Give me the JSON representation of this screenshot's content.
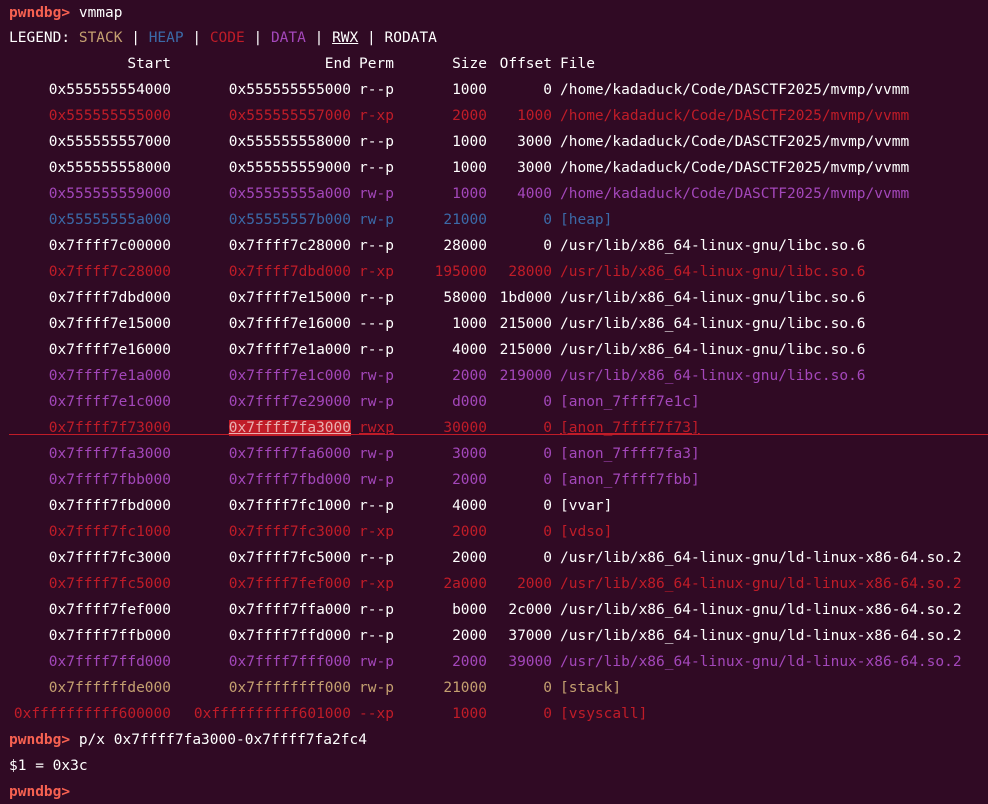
{
  "colors": {
    "prompt": "#f66151",
    "plain": "#ffffff",
    "stack": "#c4a070",
    "heap": "#3b6aa8",
    "code": "#c01c28",
    "data": "#a347ba",
    "background": "#300a24"
  },
  "prompt": "pwndbg>",
  "command_vmmap": "vmmap",
  "legend": {
    "label": "LEGEND:",
    "stack": "STACK",
    "heap": "HEAP",
    "code": "CODE",
    "data": "DATA",
    "rwx": "RWX",
    "rodata": "RODATA",
    "sep": " | "
  },
  "headers": {
    "start": "Start",
    "end": "End",
    "perm": "Perm",
    "size": "Size",
    "offset": "Offset",
    "file": "File"
  },
  "rows": [
    {
      "start": "0x555555554000",
      "end": "0x555555555000",
      "perm": "r--p",
      "size": "1000",
      "offset": "0",
      "file": "/home/kadaduck/Code/DASCTF2025/mvmp/vvmm",
      "kind": "plain"
    },
    {
      "start": "0x555555555000",
      "end": "0x555555557000",
      "perm": "r-xp",
      "size": "2000",
      "offset": "1000",
      "file": "/home/kadaduck/Code/DASCTF2025/mvmp/vvmm",
      "kind": "code"
    },
    {
      "start": "0x555555557000",
      "end": "0x555555558000",
      "perm": "r--p",
      "size": "1000",
      "offset": "3000",
      "file": "/home/kadaduck/Code/DASCTF2025/mvmp/vvmm",
      "kind": "plain"
    },
    {
      "start": "0x555555558000",
      "end": "0x555555559000",
      "perm": "r--p",
      "size": "1000",
      "offset": "3000",
      "file": "/home/kadaduck/Code/DASCTF2025/mvmp/vvmm",
      "kind": "plain"
    },
    {
      "start": "0x555555559000",
      "end": "0x55555555a000",
      "perm": "rw-p",
      "size": "1000",
      "offset": "4000",
      "file": "/home/kadaduck/Code/DASCTF2025/mvmp/vvmm",
      "kind": "data"
    },
    {
      "start": "0x55555555a000",
      "end": "0x55555557b000",
      "perm": "rw-p",
      "size": "21000",
      "offset": "0",
      "file": "[heap]",
      "kind": "heap"
    },
    {
      "start": "0x7ffff7c00000",
      "end": "0x7ffff7c28000",
      "perm": "r--p",
      "size": "28000",
      "offset": "0",
      "file": "/usr/lib/x86_64-linux-gnu/libc.so.6",
      "kind": "plain"
    },
    {
      "start": "0x7ffff7c28000",
      "end": "0x7ffff7dbd000",
      "perm": "r-xp",
      "size": "195000",
      "offset": "28000",
      "file": "/usr/lib/x86_64-linux-gnu/libc.so.6",
      "kind": "code"
    },
    {
      "start": "0x7ffff7dbd000",
      "end": "0x7ffff7e15000",
      "perm": "r--p",
      "size": "58000",
      "offset": "1bd000",
      "file": "/usr/lib/x86_64-linux-gnu/libc.so.6",
      "kind": "plain"
    },
    {
      "start": "0x7ffff7e15000",
      "end": "0x7ffff7e16000",
      "perm": "---p",
      "size": "1000",
      "offset": "215000",
      "file": "/usr/lib/x86_64-linux-gnu/libc.so.6",
      "kind": "plain"
    },
    {
      "start": "0x7ffff7e16000",
      "end": "0x7ffff7e1a000",
      "perm": "r--p",
      "size": "4000",
      "offset": "215000",
      "file": "/usr/lib/x86_64-linux-gnu/libc.so.6",
      "kind": "plain"
    },
    {
      "start": "0x7ffff7e1a000",
      "end": "0x7ffff7e1c000",
      "perm": "rw-p",
      "size": "2000",
      "offset": "219000",
      "file": "/usr/lib/x86_64-linux-gnu/libc.so.6",
      "kind": "data"
    },
    {
      "start": "0x7ffff7e1c000",
      "end": "0x7ffff7e29000",
      "perm": "rw-p",
      "size": "d000",
      "offset": "0",
      "file": "[anon_7ffff7e1c]",
      "kind": "data"
    },
    {
      "start": "0x7ffff7f73000",
      "end": "0x7ffff7fa3000",
      "perm": "rwxp",
      "size": "30000",
      "offset": "0",
      "file": "[anon_7ffff7f73]",
      "kind": "code",
      "rwx": true,
      "highlight_end": true
    },
    {
      "start": "0x7ffff7fa3000",
      "end": "0x7ffff7fa6000",
      "perm": "rw-p",
      "size": "3000",
      "offset": "0",
      "file": "[anon_7ffff7fa3]",
      "kind": "data"
    },
    {
      "start": "0x7ffff7fbb000",
      "end": "0x7ffff7fbd000",
      "perm": "rw-p",
      "size": "2000",
      "offset": "0",
      "file": "[anon_7ffff7fbb]",
      "kind": "data"
    },
    {
      "start": "0x7ffff7fbd000",
      "end": "0x7ffff7fc1000",
      "perm": "r--p",
      "size": "4000",
      "offset": "0",
      "file": "[vvar]",
      "kind": "plain"
    },
    {
      "start": "0x7ffff7fc1000",
      "end": "0x7ffff7fc3000",
      "perm": "r-xp",
      "size": "2000",
      "offset": "0",
      "file": "[vdso]",
      "kind": "code"
    },
    {
      "start": "0x7ffff7fc3000",
      "end": "0x7ffff7fc5000",
      "perm": "r--p",
      "size": "2000",
      "offset": "0",
      "file": "/usr/lib/x86_64-linux-gnu/ld-linux-x86-64.so.2",
      "kind": "plain"
    },
    {
      "start": "0x7ffff7fc5000",
      "end": "0x7ffff7fef000",
      "perm": "r-xp",
      "size": "2a000",
      "offset": "2000",
      "file": "/usr/lib/x86_64-linux-gnu/ld-linux-x86-64.so.2",
      "kind": "code"
    },
    {
      "start": "0x7ffff7fef000",
      "end": "0x7ffff7ffa000",
      "perm": "r--p",
      "size": "b000",
      "offset": "2c000",
      "file": "/usr/lib/x86_64-linux-gnu/ld-linux-x86-64.so.2",
      "kind": "plain"
    },
    {
      "start": "0x7ffff7ffb000",
      "end": "0x7ffff7ffd000",
      "perm": "r--p",
      "size": "2000",
      "offset": "37000",
      "file": "/usr/lib/x86_64-linux-gnu/ld-linux-x86-64.so.2",
      "kind": "plain"
    },
    {
      "start": "0x7ffff7ffd000",
      "end": "0x7ffff7fff000",
      "perm": "rw-p",
      "size": "2000",
      "offset": "39000",
      "file": "/usr/lib/x86_64-linux-gnu/ld-linux-x86-64.so.2",
      "kind": "data"
    },
    {
      "start": "0x7ffffffde000",
      "end": "0x7ffffffff000",
      "perm": "rw-p",
      "size": "21000",
      "offset": "0",
      "file": "[stack]",
      "kind": "stack"
    },
    {
      "start": "0xffffffffff600000",
      "end": "0xffffffffff601000",
      "perm": "--xp",
      "size": "1000",
      "offset": "0",
      "file": "[vsyscall]",
      "kind": "code"
    }
  ],
  "command_px": "p/x 0x7ffff7fa3000-0x7ffff7fa2fc4",
  "result": "$1 = 0x3c"
}
